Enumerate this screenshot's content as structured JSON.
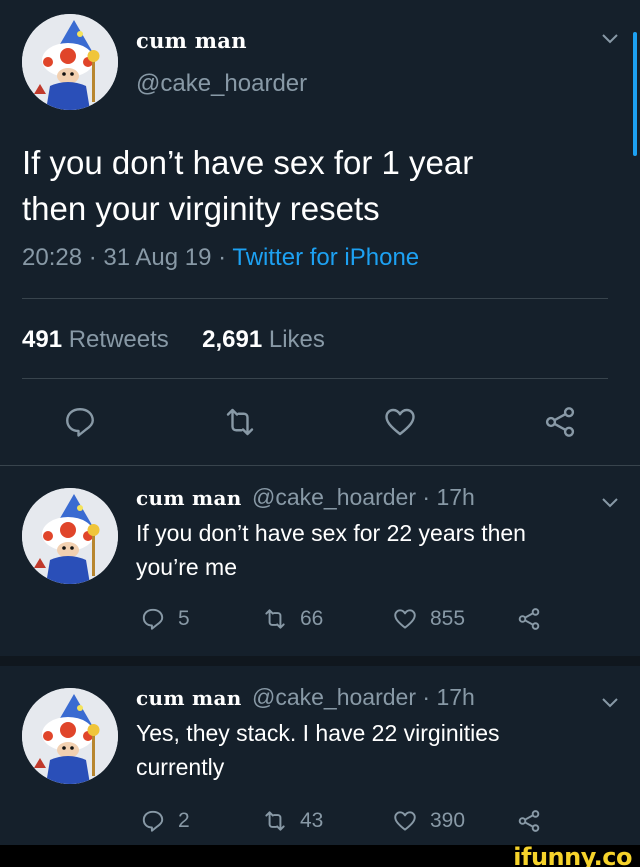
{
  "main_tweet": {
    "display_name": "cum man",
    "handle": "@cake_hoarder",
    "text_line1": "If you don’t have sex for 1 year",
    "text_line2": "then your virginity resets",
    "timestamp": "20:28 · 31 Aug 19 · ",
    "source": "Twitter for iPhone",
    "retweets_count": "491",
    "retweets_label": " Retweets",
    "likes_count": "2,691",
    "likes_label": " Likes"
  },
  "replies": [
    {
      "display_name": "cum man",
      "handle_time": "@cake_hoarder · 17h",
      "text_line1": "If you don’t have sex for 22 years then",
      "text_line2": "you’re me",
      "reply_count": "5",
      "retweet_count": "66",
      "like_count": "855"
    },
    {
      "display_name": "cum man",
      "handle_time": "@cake_hoarder · 17h",
      "text_line1": "Yes, they stack. I have 22 virginities",
      "text_line2": "currently",
      "reply_count": "2",
      "retweet_count": "43",
      "like_count": "390"
    }
  ],
  "watermark": "ifunny.co",
  "colors": {
    "background": "#15202b",
    "secondary_text": "#8899a6",
    "accent": "#1da1f2",
    "divider": "#38444d"
  },
  "icons": [
    "chevron-down-icon",
    "reply-icon",
    "retweet-icon",
    "like-icon",
    "share-icon"
  ]
}
